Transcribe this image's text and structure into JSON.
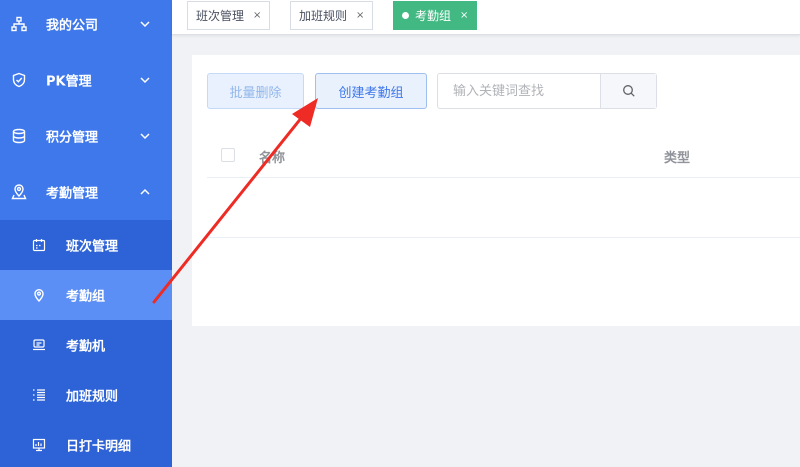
{
  "sidebar": {
    "menu": [
      {
        "label": "我的公司",
        "icon": "organization-icon",
        "expanded": false
      },
      {
        "label": "PK管理",
        "icon": "shield-icon",
        "expanded": false
      },
      {
        "label": "积分管理",
        "icon": "database-icon",
        "expanded": false
      },
      {
        "label": "考勤管理",
        "icon": "location-pin-icon",
        "expanded": true
      }
    ],
    "submenu": [
      {
        "label": "班次管理",
        "icon": "calendar-icon",
        "active": false
      },
      {
        "label": "考勤组",
        "icon": "map-pin-icon",
        "active": true
      },
      {
        "label": "考勤机",
        "icon": "attendance-machine-icon",
        "active": false
      },
      {
        "label": "加班规则",
        "icon": "list-icon",
        "active": false
      },
      {
        "label": "日打卡明细",
        "icon": "monitor-chart-icon",
        "active": false
      }
    ],
    "colors": {
      "background": "#3f78ea",
      "submenu_background": "#2d63d6",
      "active_item": "#5b8ff6"
    }
  },
  "tabs": [
    {
      "label": "班次管理",
      "close": "×",
      "active": false
    },
    {
      "label": "加班规则",
      "close": "×",
      "active": false
    },
    {
      "label": "考勤组",
      "close": "×",
      "active": true
    }
  ],
  "toolbar": {
    "batch_delete_label": "批量删除",
    "create_group_label": "创建考勤组",
    "search_placeholder": "输入关键词查找",
    "search_value": ""
  },
  "table": {
    "columns": [
      "名称",
      "类型"
    ],
    "rows": []
  },
  "colors": {
    "accent": "#3f78ea",
    "active_tab": "#42b983",
    "annotation_arrow": "#ee2b24"
  }
}
